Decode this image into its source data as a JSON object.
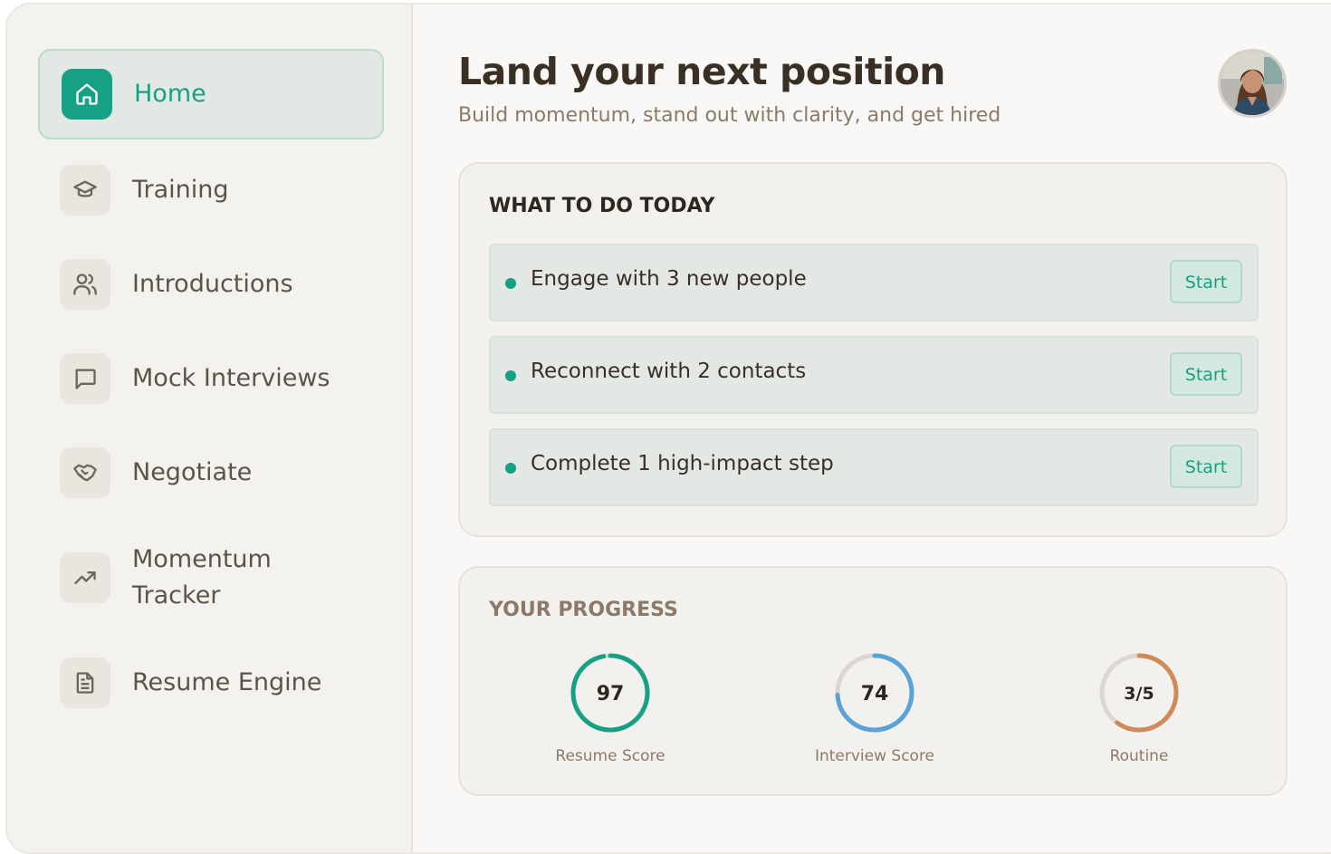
{
  "sidebar": {
    "items": [
      {
        "label": "Home",
        "icon": "home-icon"
      },
      {
        "label": "Training",
        "icon": "graduation-cap-icon"
      },
      {
        "label": "Introductions",
        "icon": "users-icon"
      },
      {
        "label": "Mock Interviews",
        "icon": "message-square-icon"
      },
      {
        "label": "Negotiate",
        "icon": "handshake-icon"
      },
      {
        "label": "Momentum Tracker",
        "icon": "trending-up-icon"
      },
      {
        "label": "Resume Engine",
        "icon": "file-text-icon"
      }
    ],
    "active": "Home"
  },
  "header": {
    "title": "Land your next position",
    "subtitle": "Build momentum, stand out with clarity, and get hired"
  },
  "today": {
    "heading": "WHAT TO DO TODAY",
    "tasks": [
      {
        "text": "Engage with 3 new people",
        "action": "Start"
      },
      {
        "text": "Reconnect with 2 contacts",
        "action": "Start"
      },
      {
        "text": "Complete 1 high-impact step",
        "action": "Start"
      }
    ]
  },
  "progress": {
    "heading": "YOUR PROGRESS",
    "metrics": [
      {
        "value": "97",
        "label": "Resume Score",
        "fraction": 0.97,
        "color": "#16a084"
      },
      {
        "value": "74",
        "label": "Interview Score",
        "fraction": 0.74,
        "color": "#5aa3d8"
      },
      {
        "value": "3/5",
        "label": "Routine",
        "fraction": 0.6,
        "color": "#d08a5a"
      }
    ]
  },
  "colors": {
    "accent": "#16a084",
    "background": "#f9f8f6",
    "sidebar": "#f4f2ee",
    "title": "#3a2f25",
    "muted": "#8c7a69"
  }
}
